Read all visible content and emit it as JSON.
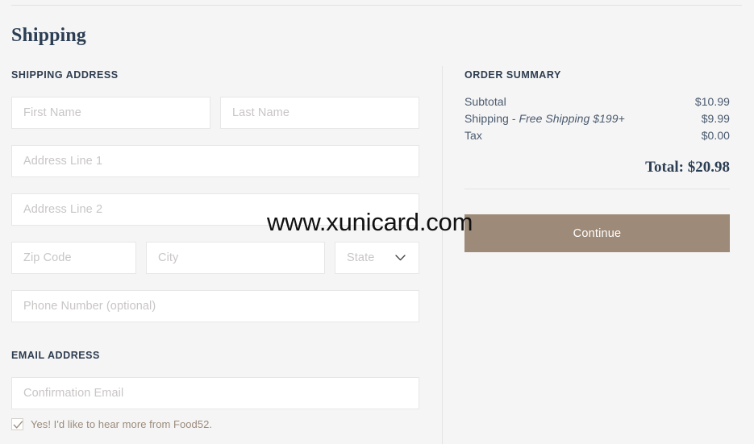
{
  "page": {
    "title": "Shipping",
    "watermark": "www.xunicard.com"
  },
  "shipping": {
    "section_label": "SHIPPING ADDRESS",
    "fields": {
      "first_name": {
        "placeholder": "First Name",
        "value": ""
      },
      "last_name": {
        "placeholder": "Last Name",
        "value": ""
      },
      "address_line_1": {
        "placeholder": "Address Line 1",
        "value": ""
      },
      "address_line_2": {
        "placeholder": "Address Line 2",
        "value": ""
      },
      "zip_code": {
        "placeholder": "Zip Code",
        "value": ""
      },
      "city": {
        "placeholder": "City",
        "value": ""
      },
      "state": {
        "placeholder": "State",
        "value": "",
        "icon": "chevron-down-icon"
      },
      "phone": {
        "placeholder": "Phone Number (optional)",
        "value": ""
      }
    }
  },
  "email": {
    "section_label": "EMAIL ADDRESS",
    "fields": {
      "confirmation_email": {
        "placeholder": "Confirmation Email",
        "value": ""
      }
    },
    "optin": {
      "label": "Yes! I'd like to hear more from Food52.",
      "checked": true,
      "icon": "check-icon"
    }
  },
  "order_summary": {
    "section_label": "ORDER SUMMARY",
    "rows": [
      {
        "label": "Subtotal",
        "note": "",
        "amount": "$10.99"
      },
      {
        "label": "Shipping",
        "note": "Free Shipping $199+",
        "separator": " - ",
        "amount": "$9.99"
      },
      {
        "label": "Tax",
        "note": "",
        "amount": "$0.00"
      }
    ],
    "total": "Total: $20.98",
    "continue_label": "Continue"
  },
  "colors": {
    "background": "#f5f5f5",
    "heading": "#2c3e54",
    "body_text": "#4a5a6e",
    "placeholder": "#c9c5c5",
    "accent_button": "#9d8a78",
    "optin_text": "#9b8b7c",
    "divider": "#e4e4e4"
  }
}
